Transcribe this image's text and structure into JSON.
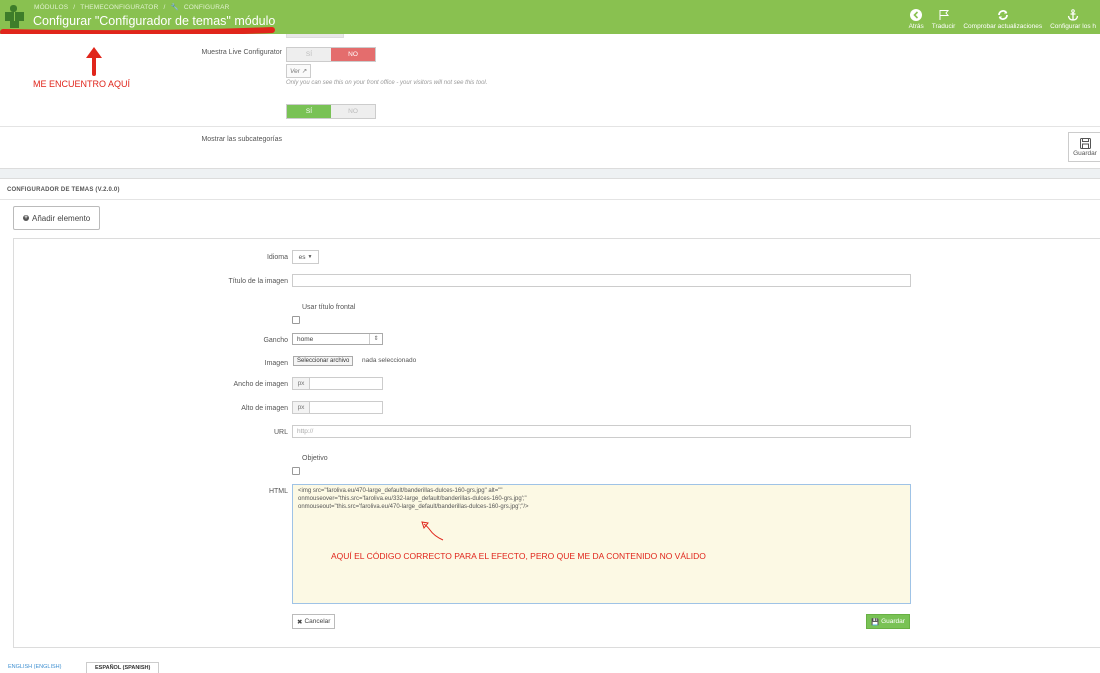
{
  "header": {
    "breadcrumbs": [
      "MÓDULOS",
      "/",
      "THEMECONFIGURATOR",
      "/",
      "CONFIGURAR"
    ],
    "title": "Configurar \"Configurador de temas\" módulo",
    "actions": [
      {
        "label": "Atrás",
        "icon": "arrow-left-circle-icon"
      },
      {
        "label": "Traducir",
        "icon": "flag-icon"
      },
      {
        "label": "Comprobar actualizaciones",
        "icon": "refresh-icon"
      },
      {
        "label": "Configurar los h",
        "icon": "anchor-icon"
      }
    ]
  },
  "settings": {
    "live_configurator": {
      "label": "Muestra Live Configurator",
      "yes": "SÍ",
      "no": "NO",
      "selected": "NO"
    },
    "view_button": "Ver",
    "help_text": "Only you can see this on your front office - your visitors will not see this tool.",
    "subcategories": {
      "label": "Mostrar las subcategorías",
      "yes": "SÍ",
      "no": "NO",
      "selected": "SÍ"
    },
    "save_label": "Guardar"
  },
  "annotations": {
    "top": "ME ENCUENTRO AQUÍ",
    "html": "AQUÍ EL CÓDIGO CORRECTO PARA EL EFECTO, PERO QUE ME DA CONTENIDO NO VÁLIDO"
  },
  "theme_config": {
    "section_title": "CONFIGURADOR DE TEMAS (V.2.0.0)",
    "add_button": "Añadir elemento",
    "form": {
      "language_label": "Idioma",
      "language_value": "es",
      "image_title_label": "Título de la imagen",
      "front_title_label": "Usar título frontal",
      "hook_label": "Gancho",
      "hook_value": "home",
      "image_label": "Imagen",
      "file_button": "Seleccionar archivo",
      "file_status": "nada seleccionado",
      "width_label": "Ancho de imagen",
      "height_label": "Alto de imagen",
      "px_unit": "px",
      "url_label": "URL",
      "url_placeholder": "http://",
      "target_label": "Objetivo",
      "html_label": "HTML",
      "html_lines": [
        "<img src=\"faroliva.eu/470-large_default/banderillas-dulces-160-grs.jpg\" alt=\"\"",
        "onmouseover=\"this.src='faroliva.eu/332-large_default/banderillas-dulces-160-grs.jpg';\"",
        "onmouseout=\"this.src='faroliva.eu/470-large_default/banderillas-dulces-160-grs.jpg';\"/>"
      ],
      "cancel_label": "Cancelar",
      "save_label": "Guardar"
    }
  },
  "language_tabs": [
    "ENGLISH (ENGLISH)",
    "ESPAÑOL (SPANISH)"
  ],
  "colors": {
    "header_green": "#89c150",
    "danger_red": "#e46d6d",
    "success_green": "#79c255",
    "annotation_red": "#e0251b"
  }
}
